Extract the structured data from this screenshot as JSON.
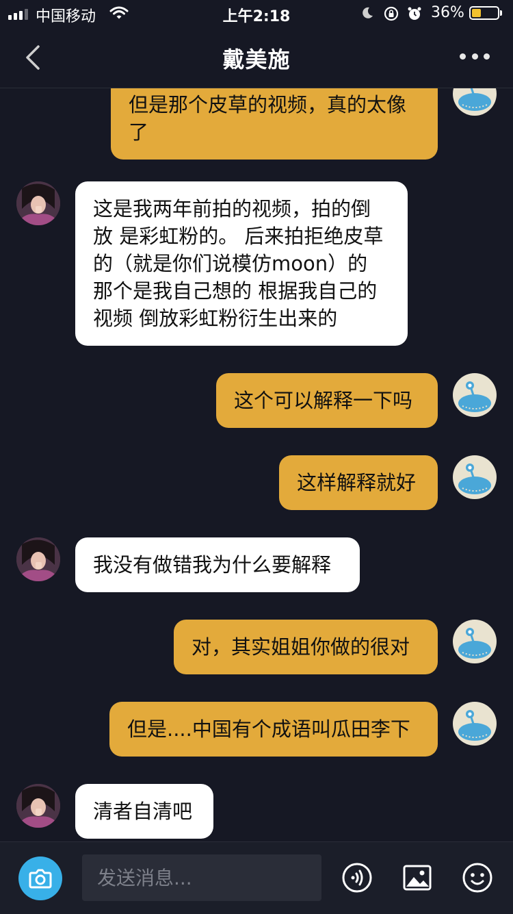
{
  "status_bar": {
    "carrier": "中国移动",
    "time": "上午2:18",
    "battery_percent": "36%",
    "battery_level": 0.36
  },
  "nav": {
    "title": "戴美施"
  },
  "messages": [
    {
      "sender": "me",
      "text": "但是那个皮草的视频，真的太像了"
    },
    {
      "sender": "her",
      "text": "这是我两年前拍的视频，拍的倒放 是彩虹粉的。 后来拍拒绝皮草的（就是你们说模仿moon）的  那个是我自己想的 根据我自己的视频 倒放彩虹粉衍生出来的"
    },
    {
      "sender": "me",
      "text": "这个可以解释一下吗"
    },
    {
      "sender": "me",
      "text": "这样解释就好"
    },
    {
      "sender": "her",
      "text": "我没有做错我为什么要解释"
    },
    {
      "sender": "me",
      "text": "对，其实姐姐你做的很对"
    },
    {
      "sender": "me",
      "text": "但是....中国有个成语叫瓜田李下"
    },
    {
      "sender": "her",
      "text": "清者自清吧"
    }
  ],
  "composer": {
    "placeholder": "发送消息..."
  },
  "colors": {
    "background": "#161824",
    "my_bubble": "#e3aa3b",
    "their_bubble": "#ffffff",
    "camera_button": "#38b0e8",
    "battery_fill": "#f2c12e"
  },
  "icons": [
    "back-chevron-icon",
    "more-dots-icon",
    "camera-icon",
    "voice-icon",
    "image-icon",
    "emoji-icon"
  ]
}
